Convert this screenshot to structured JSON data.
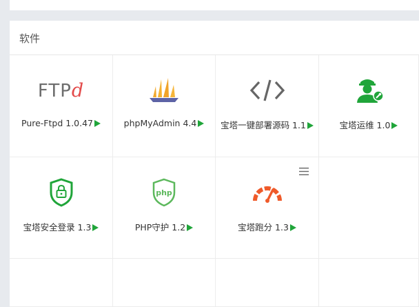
{
  "panel": {
    "title": "软件"
  },
  "apps": [
    {
      "name": "Pure-Ftpd 1.0.47",
      "icon": "ftpd-logo-icon",
      "logo_text": "FTP",
      "logo_accent": "d"
    },
    {
      "name": "phpMyAdmin 4.4",
      "icon": "sailboat-icon"
    },
    {
      "name": "宝塔一键部署源码 1.1",
      "icon": "code-brackets-icon"
    },
    {
      "name": "宝塔运维 1.0",
      "icon": "maintenance-worker-icon"
    },
    {
      "name": "宝塔安全登录 1.3",
      "icon": "shield-lock-icon"
    },
    {
      "name": "PHP守护 1.2",
      "icon": "php-shield-icon",
      "logo_text": "php"
    },
    {
      "name": "宝塔跑分 1.3",
      "icon": "speedometer-icon"
    }
  ],
  "colors": {
    "accent": "#20a53a",
    "red": "#e34a4a",
    "orange": "#ef5a2a",
    "gray": "#6d6d6d"
  }
}
